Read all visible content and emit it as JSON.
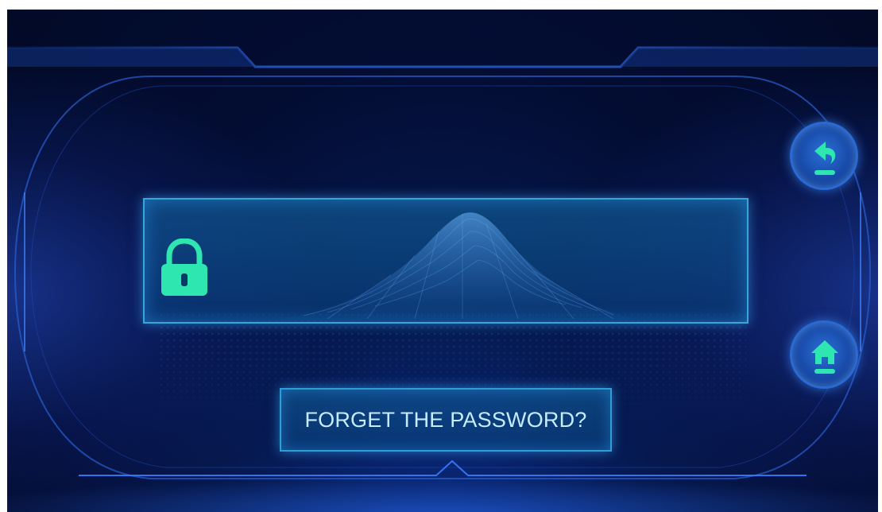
{
  "password": {
    "value": "",
    "placeholder": ""
  },
  "forget_password": {
    "label": "FORGET THE PASSWORD?"
  },
  "icons": {
    "lock": "lock-icon",
    "back": "back-arrow-icon",
    "home": "home-icon"
  },
  "colors": {
    "background": "#030d33",
    "panel_border": "#35a6d8",
    "accent_green": "#2ee6b0",
    "button_blue": "#184aa8",
    "text": "#c7ecff"
  }
}
